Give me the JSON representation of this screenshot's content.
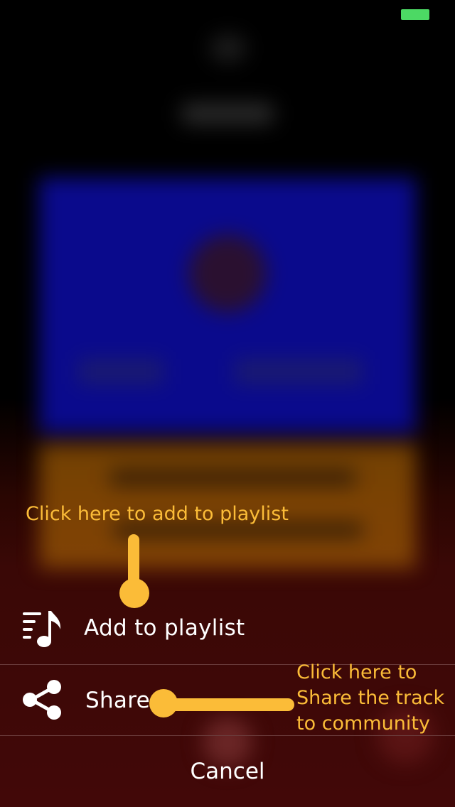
{
  "status_bar": {
    "battery_color": "#4cd964"
  },
  "action_sheet": {
    "items": [
      {
        "label": "Add to playlist",
        "icon": "playlist-add-icon"
      },
      {
        "label": "Share",
        "icon": "share-icon"
      }
    ],
    "cancel_label": "Cancel"
  },
  "tutorial": {
    "add_hint": "Click here to add to playlist",
    "share_hint_lines": [
      "Click here to",
      "Share the track",
      "to community"
    ],
    "accent_color": "#fbbc38"
  }
}
